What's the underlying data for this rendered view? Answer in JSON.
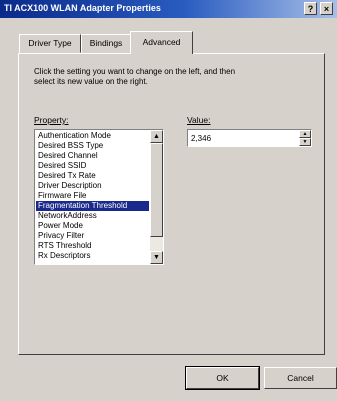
{
  "window": {
    "title": "TI ACX100 WLAN Adapter Properties",
    "help_glyph": "?",
    "close_glyph": "×"
  },
  "tabs": [
    {
      "label": "Driver Type"
    },
    {
      "label": "Bindings"
    },
    {
      "label": "Advanced"
    }
  ],
  "active_tab": "Advanced",
  "panel": {
    "instructions": "Click the setting you want to change on the left, and then\nselect its new value on the right.",
    "property_label": "Property:",
    "value_label": "Value:",
    "properties": [
      {
        "label": "Authentication Mode"
      },
      {
        "label": "Desired BSS Type"
      },
      {
        "label": "Desired Channel"
      },
      {
        "label": "Desired SSID"
      },
      {
        "label": "Desired Tx Rate"
      },
      {
        "label": "Driver Description"
      },
      {
        "label": "Firmware File"
      },
      {
        "label": "Fragmentation Threshold"
      },
      {
        "label": "NetworkAddress"
      },
      {
        "label": "Power Mode"
      },
      {
        "label": "Privacy Filter"
      },
      {
        "label": "RTS Threshold"
      },
      {
        "label": "Rx Descriptors"
      }
    ],
    "selected_property": "Fragmentation Threshold",
    "value": "2,346"
  },
  "buttons": {
    "ok": "OK",
    "cancel": "Cancel"
  }
}
